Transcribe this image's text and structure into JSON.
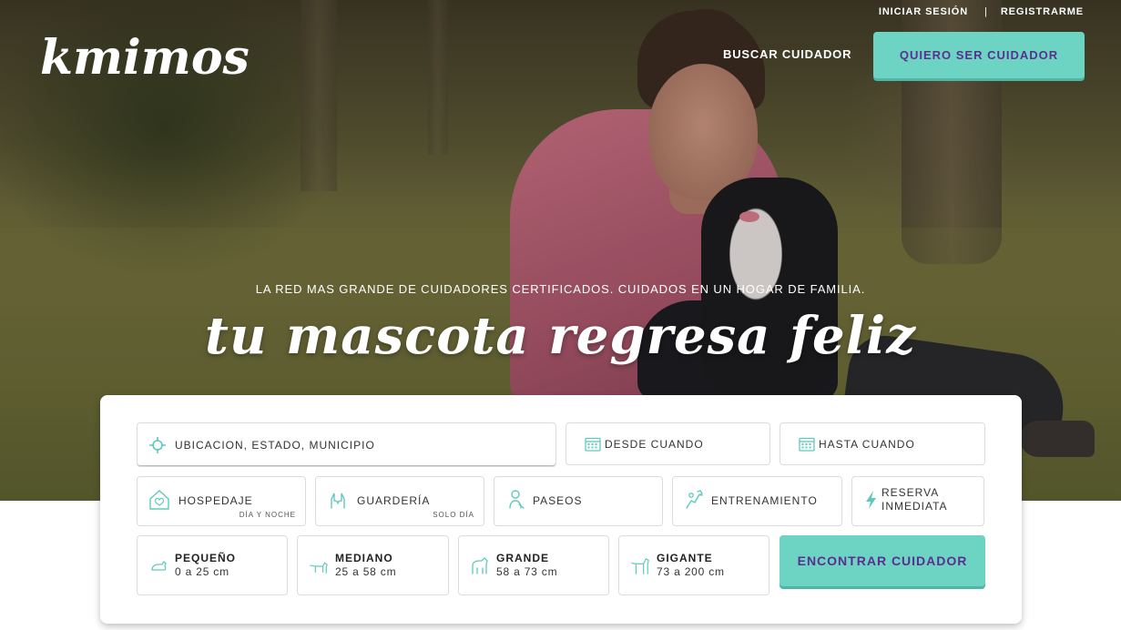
{
  "brand": {
    "logo_text": "kmimos",
    "accent": "#6dd3c3",
    "purple": "#5b2f8f"
  },
  "header": {
    "login_label": "INICIAR SESIÓN",
    "separator": "|",
    "register_label": "REGISTRARME",
    "search_caregiver_label": "BUSCAR CUIDADOR",
    "become_caregiver_label": "QUIERO SER CUIDADOR"
  },
  "hero": {
    "tagline": "LA RED MAS GRANDE DE CUIDADORES CERTIFICADOS. CUIDADOS EN UN HOGAR DE FAMILIA.",
    "headline": "tu mascota regresa feliz"
  },
  "search": {
    "location_placeholder": "UBICACION, ESTADO, MUNICIPIO",
    "from_label": "DESDE CUANDO",
    "to_label": "HASTA CUANDO",
    "services": [
      {
        "label": "HOSPEDAJE",
        "sub": "DÍA Y NOCHE",
        "icon": "house-icon"
      },
      {
        "label": "GUARDERÍA",
        "sub": "SOLO DÍA",
        "icon": "hands-icon"
      },
      {
        "label": "PASEOS",
        "sub": "",
        "icon": "walker-icon"
      },
      {
        "label": "ENTRENAMIENTO",
        "sub": "",
        "icon": "trainer-icon"
      },
      {
        "label": "RESERVA INMEDIATA",
        "sub": "",
        "icon": "lightning-icon"
      }
    ],
    "sizes": [
      {
        "name": "PEQUEÑO",
        "range": "0 a 25 cm",
        "icon": "small-dog-icon"
      },
      {
        "name": "MEDIANO",
        "range": "25 a 58 cm",
        "icon": "medium-dog-icon"
      },
      {
        "name": "GRANDE",
        "range": "58 a 73 cm",
        "icon": "large-dog-icon"
      },
      {
        "name": "GIGANTE",
        "range": "73 a 200 cm",
        "icon": "giant-dog-icon"
      }
    ],
    "submit_label": "ENCONTRAR CUIDADOR"
  }
}
